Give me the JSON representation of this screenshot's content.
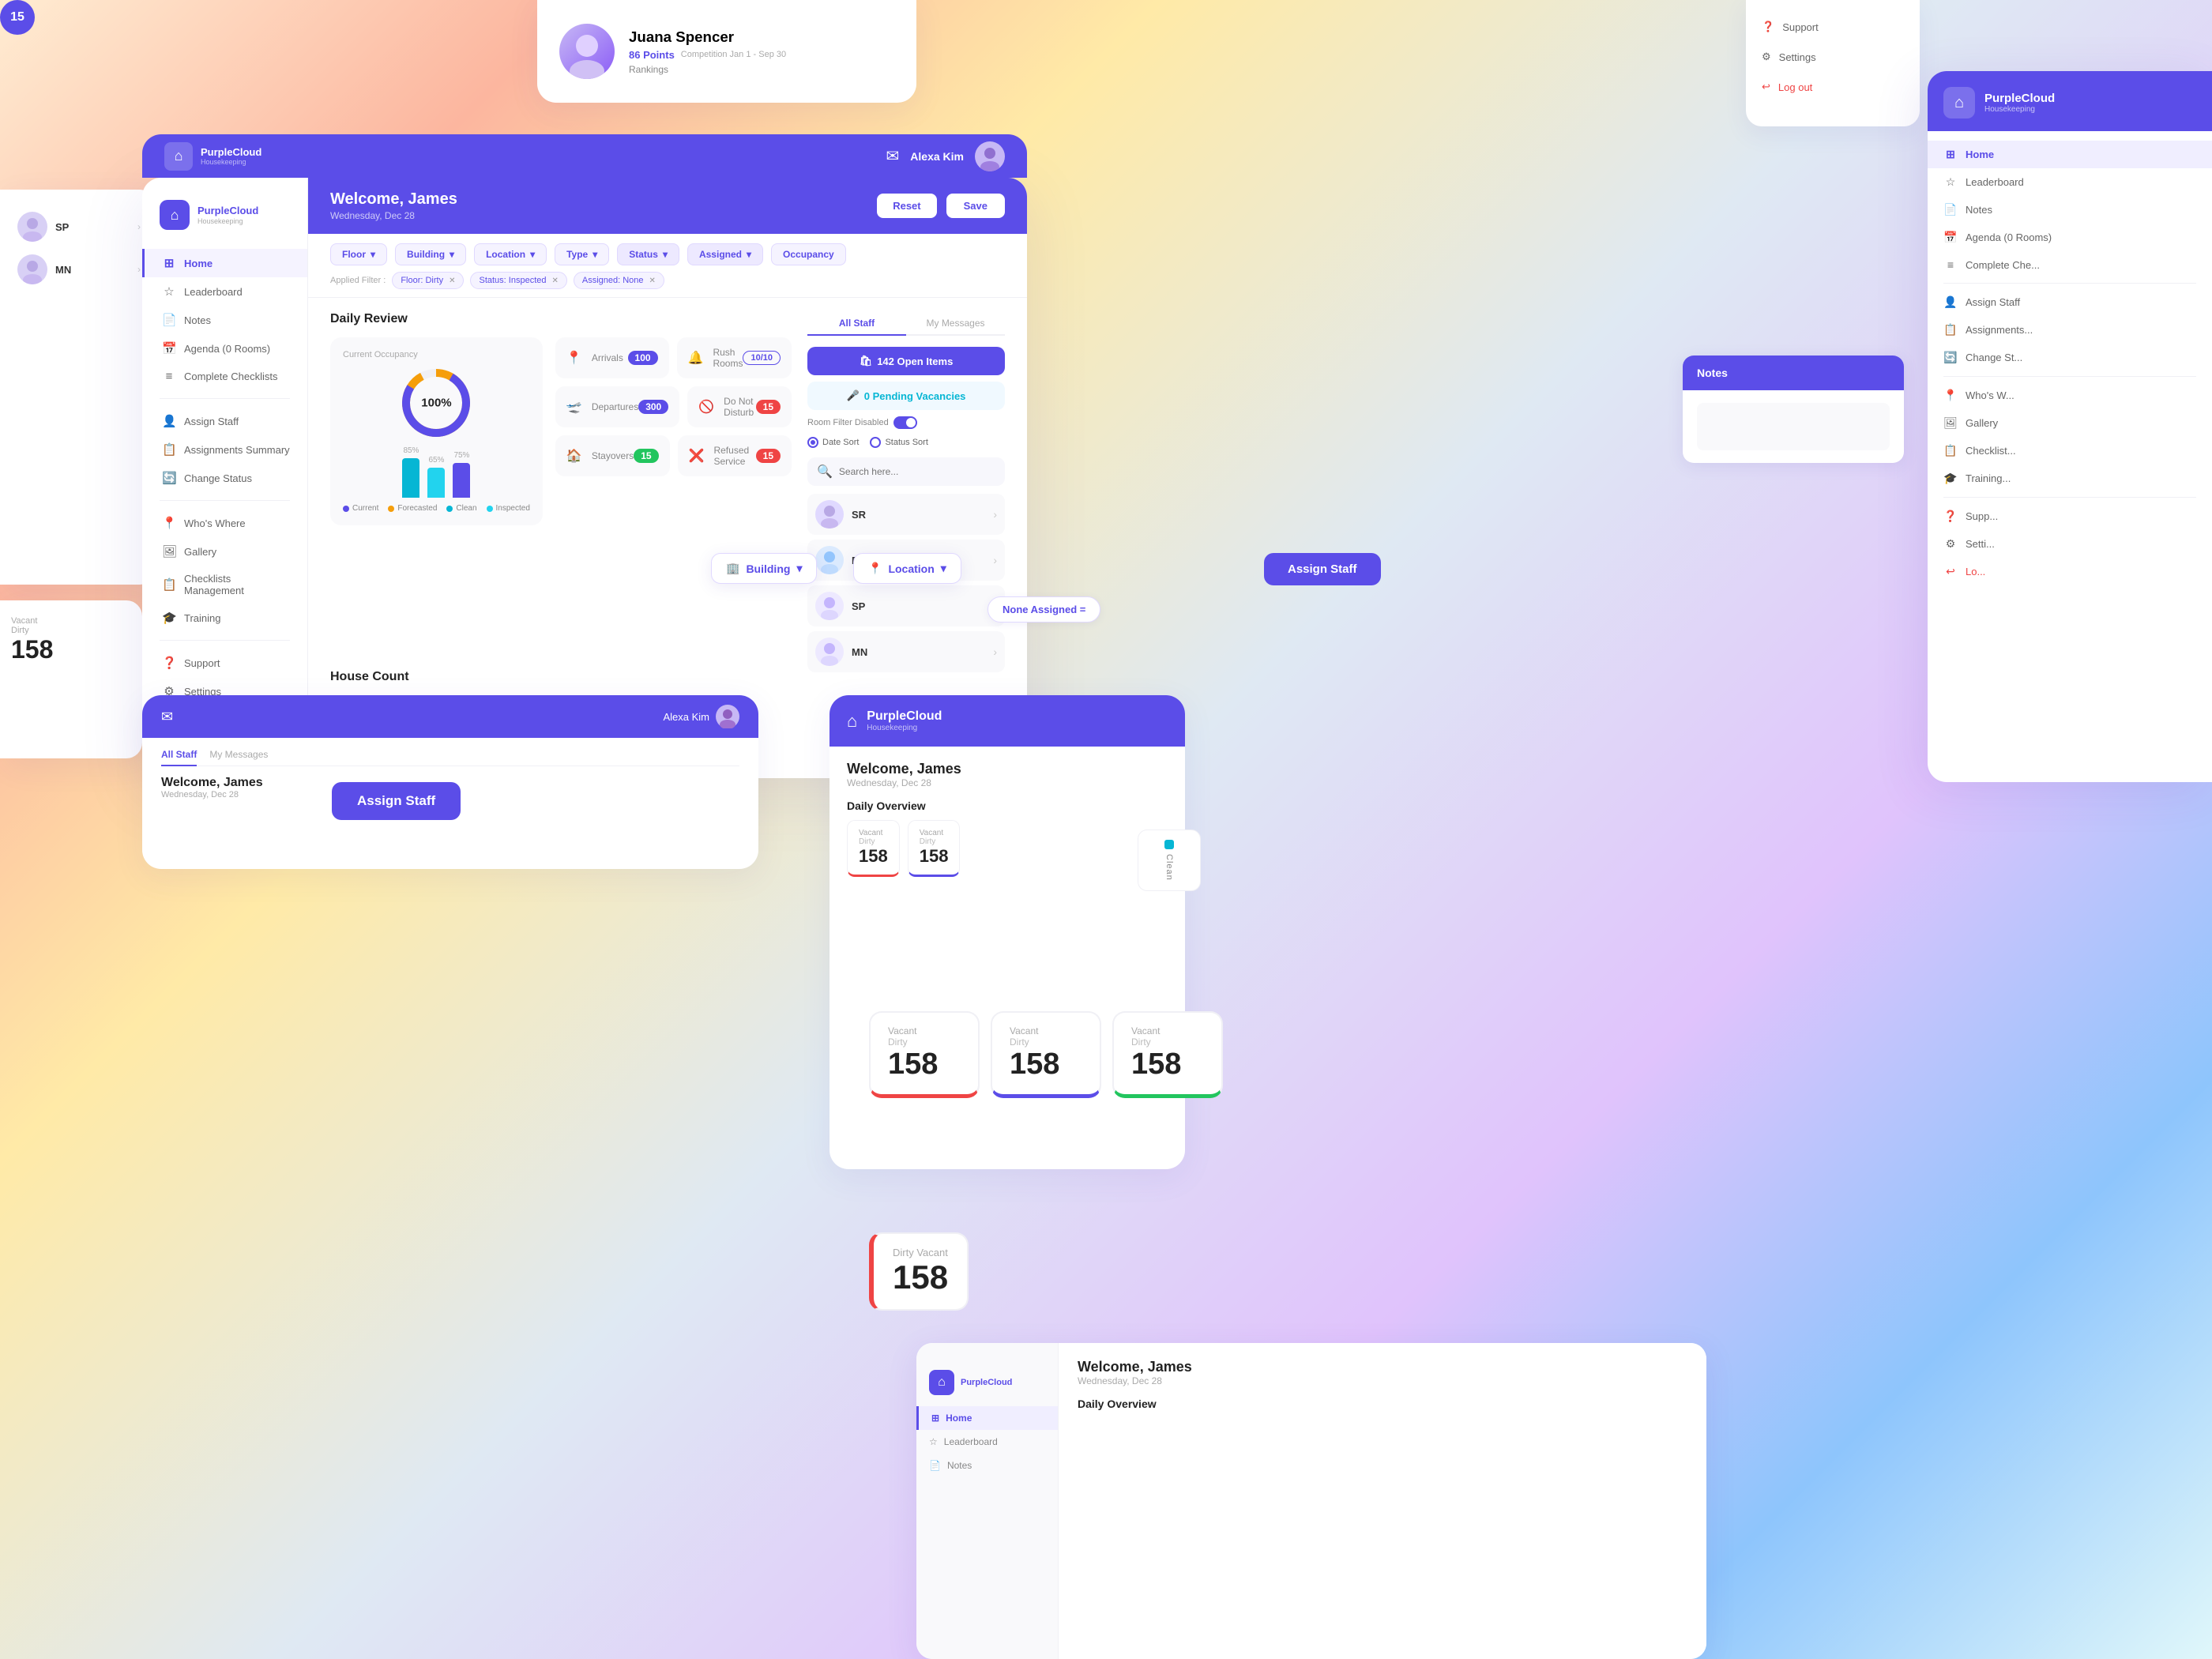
{
  "app": {
    "name": "PurpleCloud",
    "subtitle": "Housekeeping"
  },
  "header": {
    "welcome": "Welcome, James",
    "date": "Wednesday, Dec 28",
    "reset_label": "Reset",
    "save_label": "Save",
    "mail_icon": "✉",
    "user_name": "Alexa Kim"
  },
  "filters": {
    "floor_label": "Floor",
    "building_label": "Building",
    "location_label": "Location",
    "type_label": "Type",
    "status_label": "Status",
    "assigned_label": "Assigned",
    "occupancy_label": "Occupancy",
    "applied_label": "Applied Filter :",
    "chips": [
      {
        "label": "Floor: Dirty",
        "key": "floor-dirty"
      },
      {
        "label": "Status: Inspected",
        "key": "status-inspected"
      },
      {
        "label": "Assigned: None",
        "key": "assigned-none"
      }
    ]
  },
  "daily_review": {
    "title": "Daily Review",
    "occupancy": {
      "title": "Current Occupancy",
      "percent": "100%",
      "bar1_label": "85%",
      "bar2_label": "65%",
      "bar3_label": "75%",
      "legend_current": "Current",
      "legend_forecasted": "Forecasted",
      "legend_clean": "Clean",
      "legend_inspected": "Inspected"
    },
    "stats": [
      {
        "name": "Arrivals",
        "badge": "100",
        "icon": "📍",
        "color": "purple"
      },
      {
        "name": "Rush Rooms",
        "badge": "10/10",
        "icon": "🔔",
        "color": "fraction"
      },
      {
        "name": "Departures",
        "badge": "300",
        "icon": "🛫",
        "color": "purple"
      },
      {
        "name": "Do Not Disturb",
        "badge": "15",
        "icon": "🚫",
        "color": "red"
      },
      {
        "name": "Stayovers",
        "badge": "15",
        "icon": "🏠",
        "color": "green"
      },
      {
        "name": "Refused Service",
        "badge": "15",
        "icon": "❌",
        "color": "red"
      }
    ]
  },
  "house_count": {
    "title": "House Count",
    "cards": [
      {
        "label": "Vacant",
        "sub": "Dirty",
        "value": "158",
        "color": "red"
      },
      {
        "label": "Vacant",
        "sub": "Dirty",
        "value": "158",
        "color": "blue"
      },
      {
        "label": "Vacant",
        "sub": "Dirty",
        "value": "158",
        "color": "orange"
      },
      {
        "label": "Vacant",
        "sub": "Dirty",
        "value": "158",
        "color": "green"
      }
    ]
  },
  "right_panel": {
    "tab_all_staff": "All Staff",
    "tab_my_messages": "My Messages",
    "btn_open_items": "142 Open Items",
    "btn_pending": "0 Pending Vacancies",
    "room_filter": "Room Filter Disabled",
    "date_sort": "Date Sort",
    "status_sort": "Status Sort",
    "search_placeholder": "Search here...",
    "staff": [
      {
        "initials": "SR",
        "color": "purple"
      },
      {
        "initials": "EN",
        "color": "blue"
      },
      {
        "initials": "SP",
        "color": "purple"
      },
      {
        "initials": "MN",
        "color": "blue"
      }
    ]
  },
  "sidebar": {
    "nav": [
      {
        "label": "Home",
        "icon": "⊞",
        "active": true
      },
      {
        "label": "Leaderboard",
        "icon": "☆"
      },
      {
        "label": "Notes",
        "icon": "📄"
      },
      {
        "label": "Agenda (0 Rooms)",
        "icon": "📅"
      },
      {
        "label": "Complete Checklists",
        "icon": "≡"
      },
      {
        "label": "Assign Staff",
        "icon": "👤"
      },
      {
        "label": "Assignments Summary",
        "icon": "📋"
      },
      {
        "label": "Change Status",
        "icon": "🔄"
      },
      {
        "label": "Who's Where",
        "icon": "📍"
      },
      {
        "label": "Gallery",
        "icon": "🖼"
      },
      {
        "label": "Checklists Management",
        "icon": "📋"
      },
      {
        "label": "Training",
        "icon": "🎓"
      },
      {
        "label": "Support",
        "icon": "❓"
      },
      {
        "label": "Settings",
        "icon": "⚙"
      },
      {
        "label": "Log out",
        "icon": "↩",
        "red": true
      }
    ]
  },
  "right_app": {
    "nav": [
      {
        "label": "Home",
        "icon": "⊞",
        "active": true
      },
      {
        "label": "Leaderboard",
        "icon": "☆"
      },
      {
        "label": "Notes",
        "icon": "📄"
      },
      {
        "label": "Agenda (0 Rooms)",
        "icon": "📅"
      },
      {
        "label": "Complete Che...",
        "icon": "≡"
      },
      {
        "label": "Assign Staff",
        "icon": "👤"
      },
      {
        "label": "Assignments...",
        "icon": "📋"
      },
      {
        "label": "Change St...",
        "icon": "🔄"
      },
      {
        "label": "Who's W...",
        "icon": "📍"
      },
      {
        "label": "Gallery",
        "icon": "🖼"
      },
      {
        "label": "Checklist...",
        "icon": "📋"
      },
      {
        "label": "Training...",
        "icon": "🎓"
      },
      {
        "label": "Supp...",
        "icon": "❓"
      },
      {
        "label": "Setti...",
        "icon": "⚙"
      },
      {
        "label": "Lo...",
        "icon": "↩",
        "red": true
      }
    ]
  },
  "left_card": {
    "staff": [
      {
        "initials": "SP",
        "name": "SP"
      },
      {
        "initials": "MN",
        "name": "MN"
      }
    ]
  },
  "profile_menu": {
    "items": [
      {
        "label": "Support",
        "icon": "❓"
      },
      {
        "label": "Settings",
        "icon": "⚙"
      },
      {
        "label": "Log out",
        "icon": "↩",
        "red": true
      }
    ]
  },
  "user_profile": {
    "name": "Juana Spencer",
    "points": "86 Points",
    "competition": "Competition Jan 1 - Sep 30",
    "rankings": "Rankings"
  },
  "staff_count_badge": "15",
  "assign_staff_label": "Assign Staff",
  "none_assigned_label": "None Assigned =",
  "notes_label": "Notes",
  "clean_label": "Clean",
  "dirty_vacant_label": "158 Dirty Vacant",
  "bottom_card": {
    "header_title": "Alexa Kim",
    "tab1": "All Staff",
    "tab2": "My Messages"
  },
  "brc": {
    "welcome": "Welcome, James",
    "date": "Wednesday, Dec 28",
    "overview": "Daily Overview"
  }
}
